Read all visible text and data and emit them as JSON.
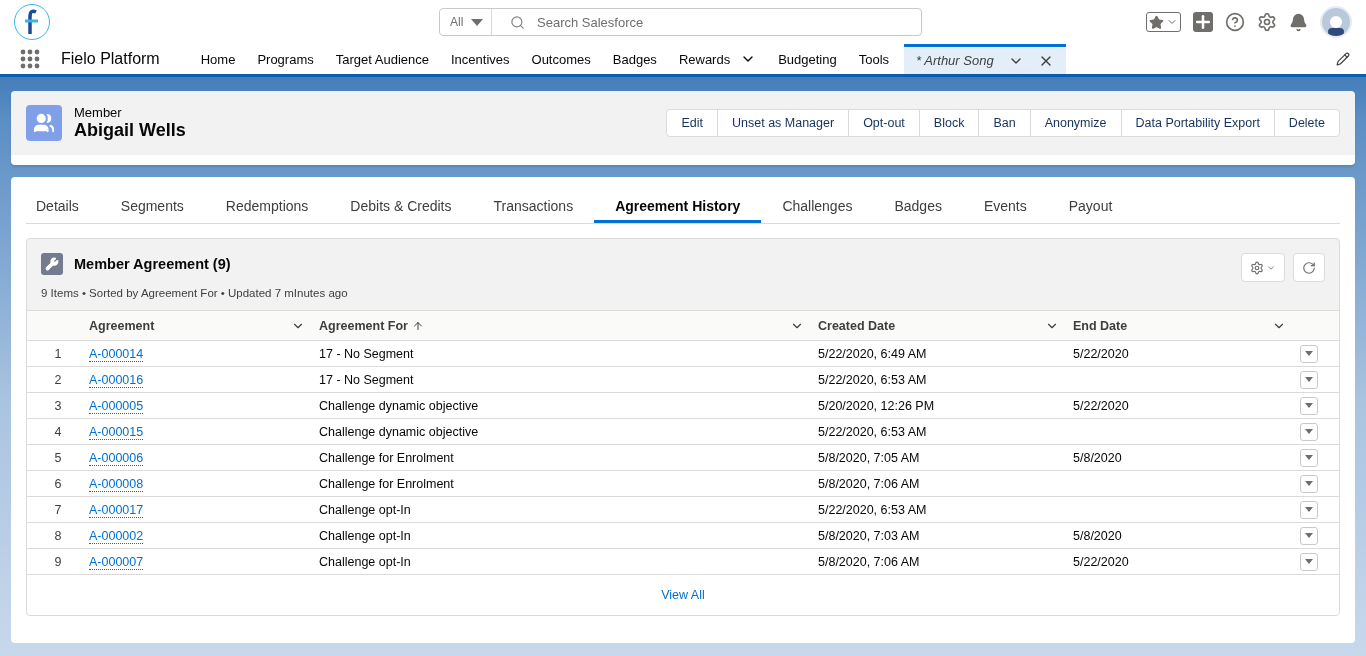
{
  "search": {
    "scope": "All",
    "placeholder": "Search Salesforce"
  },
  "app_name": "Fielo Platform",
  "nav": [
    {
      "label": "Home",
      "menu": false,
      "selected": false
    },
    {
      "label": "Programs",
      "menu": false,
      "selected": false
    },
    {
      "label": "Target Audience",
      "menu": false,
      "selected": false
    },
    {
      "label": "Incentives",
      "menu": false,
      "selected": false
    },
    {
      "label": "Outcomes",
      "menu": false,
      "selected": false
    },
    {
      "label": "Badges",
      "menu": false,
      "selected": false
    },
    {
      "label": "Rewards",
      "menu": true,
      "selected": false
    },
    {
      "label": "Budgeting",
      "menu": false,
      "selected": false
    },
    {
      "label": "Tools",
      "menu": false,
      "selected": false
    }
  ],
  "record_tab": {
    "label": "* Arthur Song",
    "selected": true
  },
  "record": {
    "type": "Member",
    "name": "Abigail Wells"
  },
  "actions": [
    "Edit",
    "Unset as Manager",
    "Opt-out",
    "Block",
    "Ban",
    "Anonymize",
    "Data Portability Export",
    "Delete"
  ],
  "tabs": [
    {
      "label": "Details",
      "selected": false
    },
    {
      "label": "Segments",
      "selected": false
    },
    {
      "label": "Redemptions",
      "selected": false
    },
    {
      "label": "Debits & Credits",
      "selected": false
    },
    {
      "label": "Transactions",
      "selected": false
    },
    {
      "label": "Agreement History",
      "selected": true
    },
    {
      "label": "Challenges",
      "selected": false
    },
    {
      "label": "Badges",
      "selected": false
    },
    {
      "label": "Events",
      "selected": false
    },
    {
      "label": "Payout",
      "selected": false
    }
  ],
  "list": {
    "title": "Member Agreement (9)",
    "meta": "9 Items • Sorted by Agreement For • Updated 7 mInutes ago",
    "columns": [
      {
        "label": "Agreement",
        "sorted": false
      },
      {
        "label": "Agreement For",
        "sorted": true
      },
      {
        "label": "Created Date",
        "sorted": false
      },
      {
        "label": "End Date",
        "sorted": false
      }
    ],
    "rows": [
      {
        "num": "1",
        "agreement": "A-000014",
        "for": "17 - No Segment",
        "created": "5/22/2020, 6:49 AM",
        "end": "5/22/2020"
      },
      {
        "num": "2",
        "agreement": "A-000016",
        "for": "17 - No Segment",
        "created": "5/22/2020, 6:53 AM",
        "end": ""
      },
      {
        "num": "3",
        "agreement": "A-000005",
        "for": "Challenge dynamic objective",
        "created": "5/20/2020, 12:26 PM",
        "end": "5/22/2020"
      },
      {
        "num": "4",
        "agreement": "A-000015",
        "for": "Challenge dynamic objective",
        "created": "5/22/2020, 6:53 AM",
        "end": ""
      },
      {
        "num": "5",
        "agreement": "A-000006",
        "for": "Challenge for Enrolment",
        "created": "5/8/2020, 7:05 AM",
        "end": "5/8/2020"
      },
      {
        "num": "6",
        "agreement": "A-000008",
        "for": "Challenge for Enrolment",
        "created": "5/8/2020, 7:06 AM",
        "end": ""
      },
      {
        "num": "7",
        "agreement": "A-000017",
        "for": "Challenge opt-In",
        "created": "5/22/2020, 6:53 AM",
        "end": ""
      },
      {
        "num": "8",
        "agreement": "A-000002",
        "for": "Challenge opt-In",
        "created": "5/8/2020, 7:03 AM",
        "end": "5/8/2020"
      },
      {
        "num": "9",
        "agreement": "A-000007",
        "for": "Challenge opt-In",
        "created": "5/8/2020, 7:06 AM",
        "end": "5/22/2020"
      }
    ],
    "view_all": "View All"
  }
}
